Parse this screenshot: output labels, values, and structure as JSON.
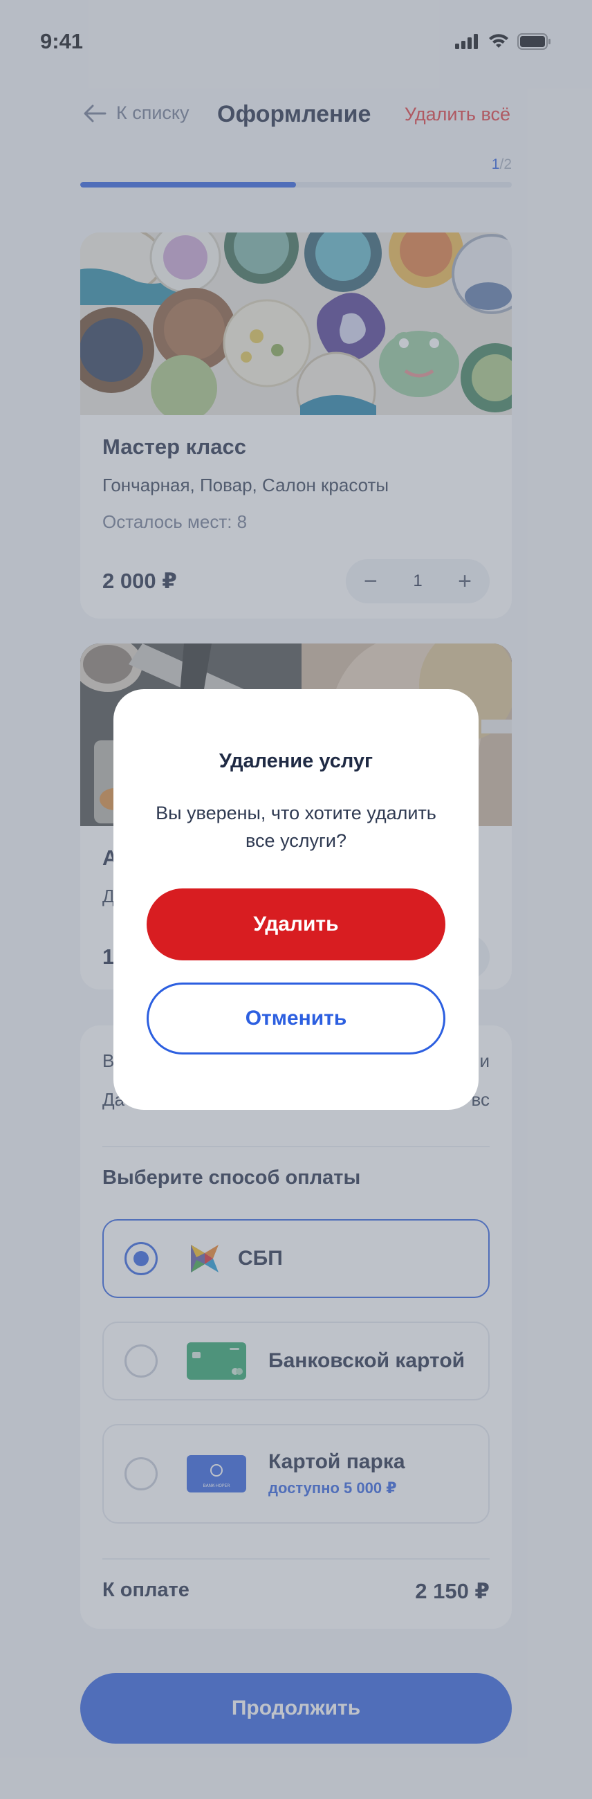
{
  "status_bar": {
    "time": "9:41"
  },
  "header": {
    "back_label": "К списку",
    "title": "Оформление",
    "delete_all": "Удалить всё"
  },
  "progress": {
    "current": "1",
    "separator": "/",
    "total": "2",
    "fraction": 0.5
  },
  "cards": [
    {
      "title": "Мастер класс",
      "categories": "Гончарная, Повар, Салон красоты",
      "places_left": "Осталось мест: 8",
      "price": "2 000 ₽",
      "quantity": "1",
      "minus": "−",
      "plus": "+"
    },
    {
      "title_partial": "А",
      "sub_partial": "Д",
      "price_partial": "15"
    }
  ],
  "info_partial": {
    "line1_left": "В",
    "line1_right": "и",
    "line2_left": "Да",
    "line2_right": "вс"
  },
  "payment": {
    "heading": "Выберите способ оплаты",
    "options": [
      {
        "label": "СБП",
        "selected": true,
        "icon": "sbp-logo-icon"
      },
      {
        "label": "Банковской картой",
        "selected": false,
        "icon": "bank-card-icon"
      },
      {
        "label": "Картой парка",
        "sub": "доступно 5 000 ₽",
        "selected": false,
        "icon": "park-card-icon",
        "card_text": "BANK-HOPER"
      }
    ],
    "total_label": "К оплате",
    "total_value": "2 150 ₽"
  },
  "continue_label": "Продолжить",
  "modal": {
    "title": "Удаление услуг",
    "text": "Вы уверены, что хотите удалить все услуги?",
    "confirm": "Удалить",
    "cancel": "Отменить"
  },
  "colors": {
    "accent": "#2c5fe0",
    "danger": "#d81d21",
    "delete_link": "#e2373a",
    "overlay": "rgba(120,128,142,0.48)"
  }
}
